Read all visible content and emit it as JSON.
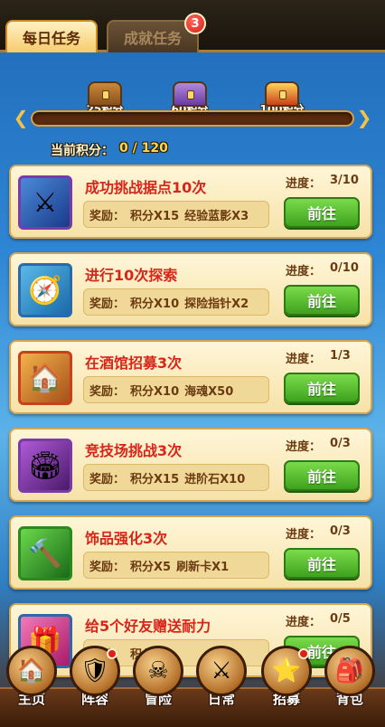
{
  "tabs": {
    "daily_label": "每日任务",
    "achievement_label": "成就任务",
    "achievement_badge": "3"
  },
  "rewards": {
    "progress_fraction": 0.0,
    "chests": [
      {
        "label": "25积分",
        "icon": "chest-bronze-icon"
      },
      {
        "label": "60积分",
        "icon": "chest-skull-icon"
      },
      {
        "label": "100积分",
        "icon": "chest-gold-icon"
      }
    ]
  },
  "points": {
    "label": "当前积分：",
    "value": "0 / 120"
  },
  "tasks": [
    {
      "title": "成功挑战据点10次",
      "reward_label": "奖励：",
      "reward_items": "积分X15",
      "reward_items_2": "经验蓝影X3",
      "progress_label": "进度：",
      "progress": "3/10",
      "button": "前往",
      "icon": "crossed-swords-icon"
    },
    {
      "title": "进行10次探索",
      "reward_label": "奖励：",
      "reward_items": "积分X10",
      "reward_items_2": "探险指针X2",
      "progress_label": "进度：",
      "progress": "0/10",
      "button": "前往",
      "icon": "compass-icon"
    },
    {
      "title": "在酒馆招募3次",
      "reward_label": "奖励：",
      "reward_items": "积分X10",
      "reward_items_2": "海魂X50",
      "progress_label": "进度：",
      "progress": "1/3",
      "button": "前往",
      "icon": "tavern-icon"
    },
    {
      "title": "竞技场挑战3次",
      "reward_label": "奖励：",
      "reward_items": "积分X15",
      "reward_items_2": "进阶石X10",
      "progress_label": "进度：",
      "progress": "0/3",
      "button": "前往",
      "icon": "arena-icon"
    },
    {
      "title": "饰品强化3次",
      "reward_label": "奖励：",
      "reward_items": "积分X5",
      "reward_items_2": "刷新卡X1",
      "progress_label": "进度：",
      "progress": "0/3",
      "button": "前往",
      "icon": "hammer-icon"
    },
    {
      "title": "给5个好友赠送耐力",
      "reward_label": "奖励：",
      "reward_items": "积分",
      "reward_items_2": "",
      "progress_label": "进度：",
      "progress": "0/5",
      "button": "前往",
      "icon": "gift-icon"
    }
  ],
  "nav": [
    {
      "label": "主页",
      "icon": "home-icon",
      "dot": false
    },
    {
      "label": "阵容",
      "icon": "lineup-icon",
      "dot": true
    },
    {
      "label": "冒险",
      "icon": "skull-adventure-icon",
      "dot": false
    },
    {
      "label": "日常",
      "icon": "daily-swords-icon",
      "dot": false
    },
    {
      "label": "招募",
      "icon": "recruit-icon",
      "dot": true
    },
    {
      "label": "背包",
      "icon": "bag-icon",
      "dot": false
    }
  ]
}
